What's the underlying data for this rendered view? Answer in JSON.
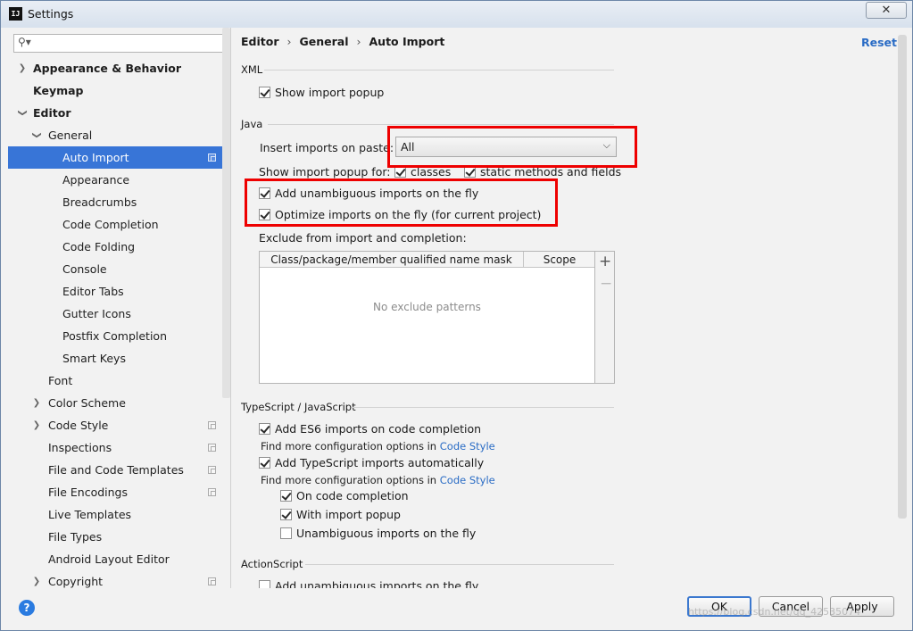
{
  "window": {
    "title": "Settings",
    "close_label": "✕"
  },
  "search": {
    "placeholder": "",
    "value": ""
  },
  "sidebar": {
    "items": [
      {
        "label": "Appearance & Behavior"
      },
      {
        "label": "Keymap"
      },
      {
        "label": "Editor"
      },
      {
        "label": "General"
      },
      {
        "label": "Auto Import"
      },
      {
        "label": "Appearance"
      },
      {
        "label": "Breadcrumbs"
      },
      {
        "label": "Code Completion"
      },
      {
        "label": "Code Folding"
      },
      {
        "label": "Console"
      },
      {
        "label": "Editor Tabs"
      },
      {
        "label": "Gutter Icons"
      },
      {
        "label": "Postfix Completion"
      },
      {
        "label": "Smart Keys"
      },
      {
        "label": "Font"
      },
      {
        "label": "Color Scheme"
      },
      {
        "label": "Code Style"
      },
      {
        "label": "Inspections"
      },
      {
        "label": "File and Code Templates"
      },
      {
        "label": "File Encodings"
      },
      {
        "label": "Live Templates"
      },
      {
        "label": "File Types"
      },
      {
        "label": "Android Layout Editor"
      },
      {
        "label": "Copyright"
      }
    ],
    "selected": "Auto Import"
  },
  "breadcrumb": {
    "part1": "Editor",
    "part2": "General",
    "part3": "Auto Import"
  },
  "reset_label": "Reset",
  "xml": {
    "title": "XML",
    "show_import_popup": "Show import popup"
  },
  "java": {
    "title": "Java",
    "insert_imports_label": "Insert imports on paste:",
    "insert_imports_value": "All",
    "show_popup_for": "Show import popup for:",
    "classes": "classes",
    "static_methods": "static methods and fields",
    "add_unambiguous": "Add unambiguous imports on the fly",
    "optimize_imports": "Optimize imports on the fly (for current project)",
    "exclude_label": "Exclude from import and completion:",
    "table_col1": "Class/package/member qualified name mask",
    "table_col2": "Scope",
    "table_empty": "No exclude patterns"
  },
  "typescript": {
    "title": "TypeScript / JavaScript",
    "es6_imports": "Add ES6 imports on code completion",
    "find_more_1": "Find more configuration options in",
    "code_style_link": "Code Style",
    "ts_imports": "Add TypeScript imports automatically",
    "find_more_2": "Find more configuration options in",
    "on_completion": "On code completion",
    "with_popup": "With import popup",
    "unambiguous": "Unambiguous imports on the fly"
  },
  "actionscript": {
    "title": "ActionScript",
    "add_unambiguous": "Add unambiguous imports on the fly"
  },
  "footer": {
    "ok": "OK",
    "cancel": "Cancel",
    "apply": "Apply",
    "help": "?"
  },
  "watermark": "https://blog.csdn.net/qq_42535074",
  "colors": {
    "accent": "#3875d7",
    "link": "#2a6cc5",
    "highlight_box": "#ee0000"
  }
}
